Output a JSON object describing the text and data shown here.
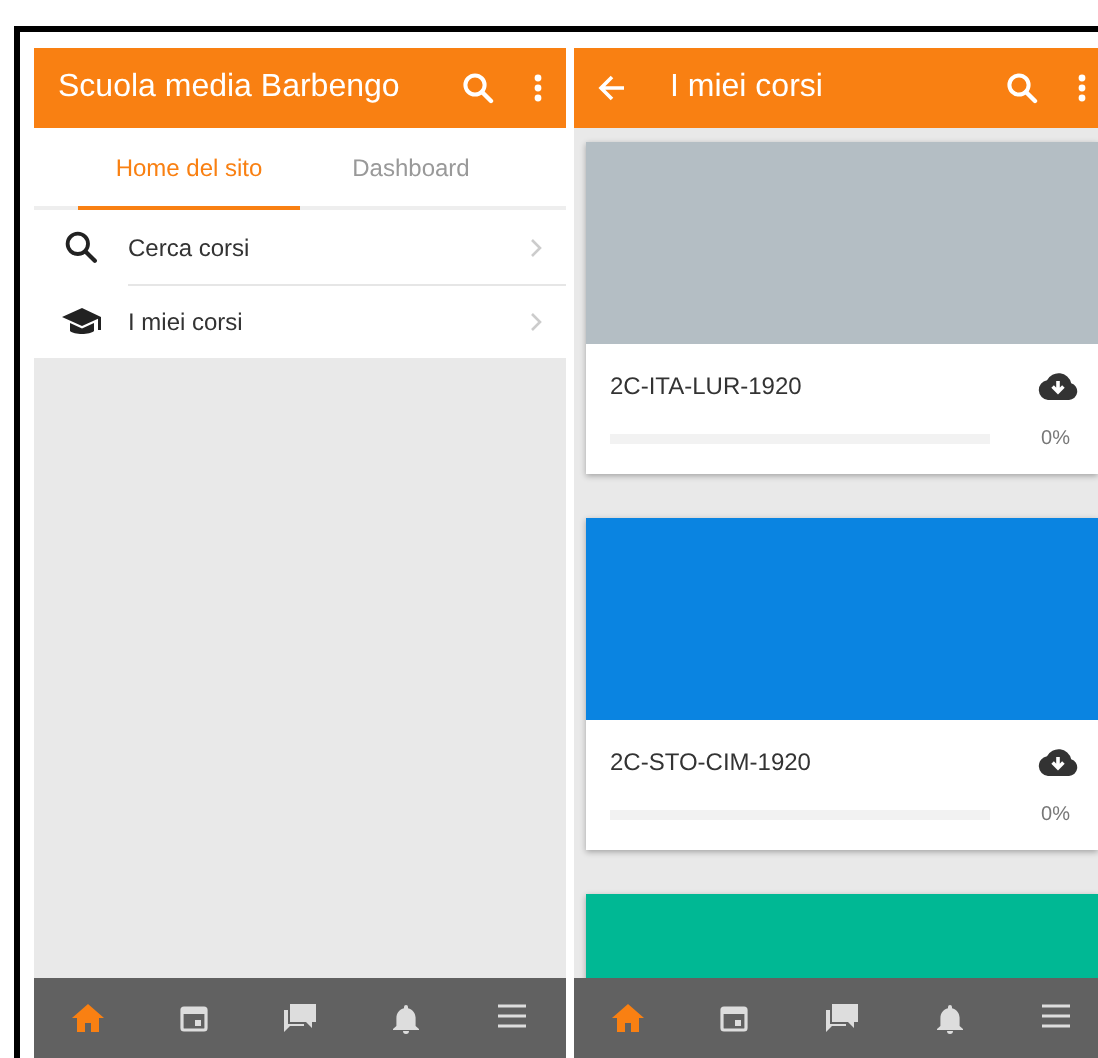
{
  "screens": [
    {
      "kind": "home",
      "header": {
        "title": "Scuola media Barbengo"
      },
      "tabs": [
        {
          "label": "Home del sito",
          "selected": true
        },
        {
          "label": "Dashboard",
          "selected": false
        }
      ],
      "items": [
        {
          "kind": "search",
          "label": "Cerca corsi"
        },
        {
          "kind": "courses",
          "label": "I miei corsi"
        }
      ],
      "bottom_nav": [
        {
          "kind": "home",
          "selected": true
        },
        {
          "kind": "calendar",
          "selected": false
        },
        {
          "kind": "messages",
          "selected": false
        },
        {
          "kind": "notifications",
          "selected": false
        },
        {
          "kind": "menu",
          "selected": false
        }
      ]
    },
    {
      "kind": "courses",
      "header": {
        "title": "I miei corsi"
      },
      "courses": [
        {
          "color": "#b4bec4",
          "title": "2C-ITA-LUR-1920",
          "level": 0,
          "reading": "0%"
        },
        {
          "color": "#0a84e1",
          "title": "2C-STO-CIM-1920",
          "level": 0,
          "reading": "0%"
        },
        {
          "color": "#00b894"
        }
      ],
      "bottom_nav": [
        {
          "kind": "home",
          "selected": true
        },
        {
          "kind": "calendar",
          "selected": false
        },
        {
          "kind": "messages",
          "selected": false
        },
        {
          "kind": "notifications",
          "selected": false
        },
        {
          "kind": "menu",
          "selected": false
        }
      ]
    }
  ]
}
